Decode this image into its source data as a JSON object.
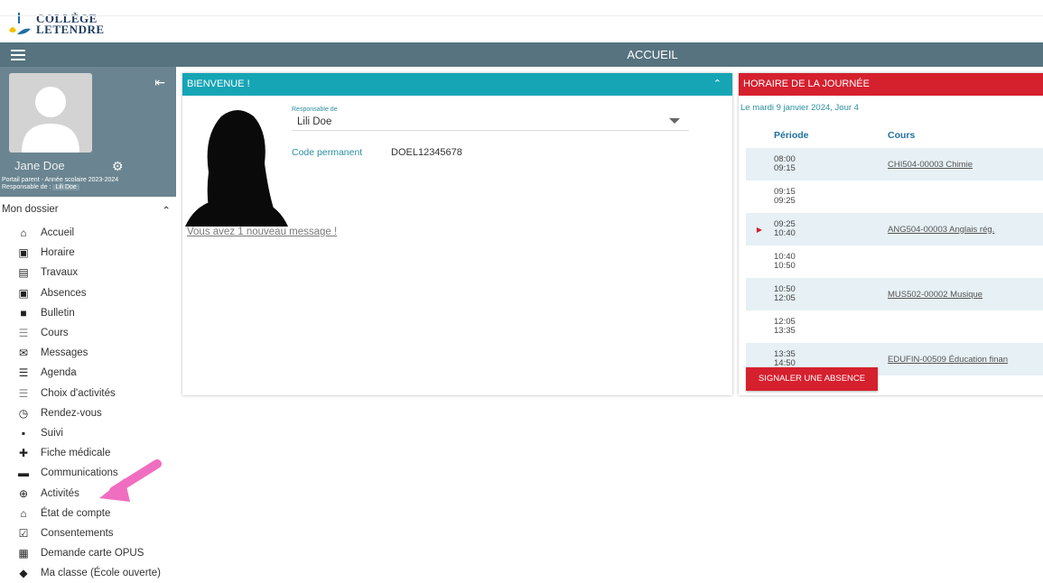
{
  "brand": {
    "line1": "COLLÈGE",
    "line2": "LETENDRE"
  },
  "topbar": {
    "title": "ACCUEIL",
    "menu_icon": "hamburger-icon"
  },
  "profile": {
    "name": "Jane Doe",
    "subtitle": "Portail parent - Année scolaire 2023-2024",
    "responsable_label": "Responsable de :",
    "responsable_value": "Lili Doe"
  },
  "sidebar": {
    "section_title": "Mon dossier",
    "items": [
      {
        "label": "Accueil",
        "icon": "home-icon"
      },
      {
        "label": "Horaire",
        "icon": "calendar-icon"
      },
      {
        "label": "Travaux",
        "icon": "clipboard-icon"
      },
      {
        "label": "Absences",
        "icon": "calendar-absence-icon"
      },
      {
        "label": "Bulletin",
        "icon": "report-icon"
      },
      {
        "label": "Cours",
        "icon": "list-icon"
      },
      {
        "label": "Messages",
        "icon": "mail-icon"
      },
      {
        "label": "Agenda",
        "icon": "agenda-icon"
      },
      {
        "label": "Choix d'activités",
        "icon": "choice-list-icon"
      },
      {
        "label": "Rendez-vous",
        "icon": "clock-icon"
      },
      {
        "label": "Suivi",
        "icon": "chat-icon"
      },
      {
        "label": "Fiche médicale",
        "icon": "medical-icon"
      },
      {
        "label": "Communications",
        "icon": "folder-icon"
      },
      {
        "label": "Activités",
        "icon": "basketball-icon"
      },
      {
        "label": "État de compte",
        "icon": "bank-icon"
      },
      {
        "label": "Consentements",
        "icon": "checkbox-icon"
      },
      {
        "label": "Demande carte OPUS",
        "icon": "bus-icon"
      },
      {
        "label": "Ma classe (École ouverte)",
        "icon": "graduation-cap-icon"
      }
    ]
  },
  "welcome": {
    "title": "BIENVENUE !",
    "responsable_label": "Responsable de",
    "responsable_value": "Lili Doe",
    "code_label": "Code permanent",
    "code_value": "DOEL12345678",
    "message_link": "Vous avez 1 nouveau message !"
  },
  "schedule": {
    "title": "HORAIRE DE LA JOURNÉE",
    "date": "Le mardi 9 janvier 2024, Jour 4",
    "col_period": "Période",
    "col_course": "Cours",
    "rows": [
      {
        "start": "08:00",
        "end": "09:15",
        "course": "CHI504-00003 Chimie",
        "current": false
      },
      {
        "start": "09:15",
        "end": "09:25",
        "course": "",
        "current": false
      },
      {
        "start": "09:25",
        "end": "10:40",
        "course": "ANG504-00003 Anglais rég.",
        "current": true
      },
      {
        "start": "10:40",
        "end": "10:50",
        "course": "",
        "current": false
      },
      {
        "start": "10:50",
        "end": "12:05",
        "course": "MUS502-00002 Musique",
        "current": false
      },
      {
        "start": "12:05",
        "end": "13:35",
        "course": "",
        "current": false
      },
      {
        "start": "13:35",
        "end": "14:50",
        "course": "EDUFIN-00509 Éducation finan",
        "current": false
      }
    ],
    "absence_button": "SIGNALER UNE ABSENCE"
  },
  "colors": {
    "topbar": "#56737f",
    "teal": "#16a5b5",
    "red": "#d5202e",
    "annotation_arrow": "#f06ec0"
  }
}
